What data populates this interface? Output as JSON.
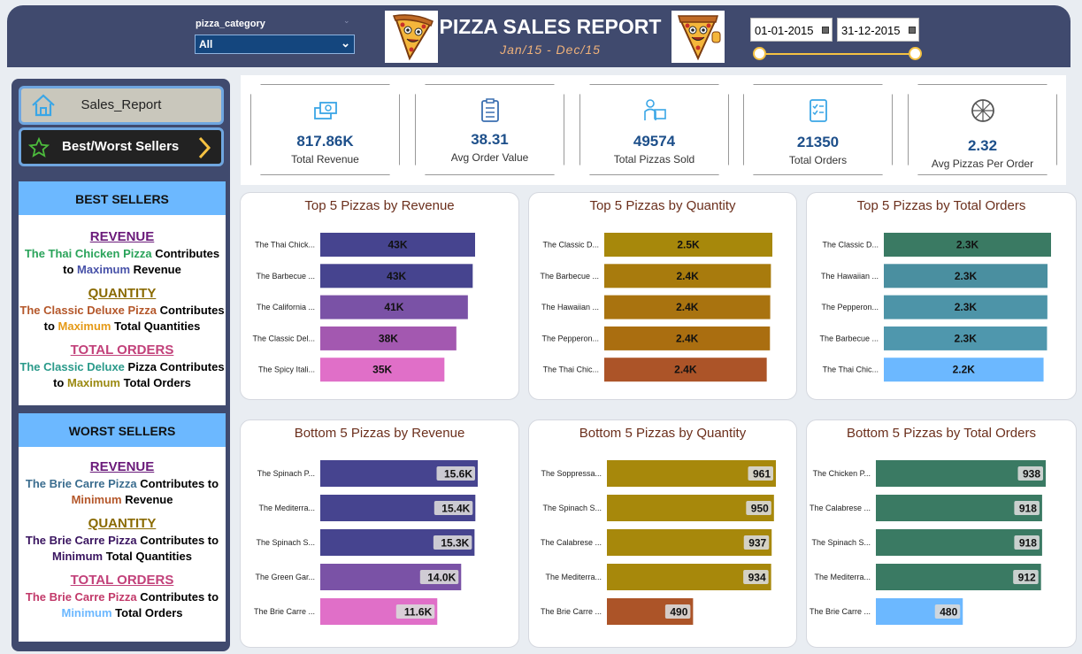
{
  "header": {
    "title": "PIZZA SALES REPORT",
    "subtitle": "Jan/15  -  Dec/15",
    "slicer_label": "pizza_category",
    "slicer_value": "All",
    "date_start": "01-01-2015",
    "date_end": "31-12-2015"
  },
  "nav": {
    "sales_report": "Sales_Report",
    "best_worst": "Best/Worst Sellers"
  },
  "best_sellers": {
    "title": "BEST SELLERS",
    "revenue_heading": "REVENUE",
    "revenue_pizza": "The Thai Chicken Pizza",
    "revenue_mid": " Contributes to ",
    "revenue_key": "Maximum",
    "revenue_tail": " Revenue",
    "quantity_heading": "QUANTITY",
    "quantity_pizza": "The Classic Deluxe Pizza",
    "quantity_mid": " Contributes to ",
    "quantity_key": "Maximum",
    "quantity_tail": " Total Quantities",
    "orders_heading": "TOTAL ORDERS",
    "orders_pizza": "The Classic Deluxe",
    "orders_mid": " Pizza Contributes to ",
    "orders_key": "Maximum",
    "orders_tail": " Total Orders"
  },
  "worst_sellers": {
    "title": "WORST SELLERS",
    "revenue_heading": "REVENUE",
    "revenue_pizza": "The Brie Carre Pizza",
    "revenue_mid": " Contributes to ",
    "revenue_key": "Minimum",
    "revenue_tail": " Revenue",
    "quantity_heading": "QUANTITY",
    "quantity_pizza": "The Brie Carre Pizza",
    "quantity_mid": " Contributes to ",
    "quantity_key": "Minimum",
    "quantity_tail": " Total Quantities",
    "orders_heading": "TOTAL ORDERS",
    "orders_pizza": "The Brie Carre Pizza",
    "orders_mid": " Contributes to ",
    "orders_key": "Minimum",
    "orders_tail": " Total Orders"
  },
  "kpis": [
    {
      "value": "817.86K",
      "label": "Total Revenue",
      "icon": "money-icon"
    },
    {
      "value": "38.31",
      "label": "Avg Order Value",
      "icon": "clipboard-icon"
    },
    {
      "value": "49574",
      "label": "Total Pizzas Sold",
      "icon": "delivery-icon"
    },
    {
      "value": "21350",
      "label": "Total Orders",
      "icon": "checklist-icon"
    },
    {
      "value": "2.32",
      "label": "Avg Pizzas Per Order",
      "icon": "pizza-icon"
    }
  ],
  "colors": {
    "header_bg": "#404a6e",
    "accent_gold": "#f5c242",
    "title_brown": "#6b2f1c",
    "kpi_value": "#1d4f8a",
    "best_head": "#6cb8ff"
  },
  "chart_data": [
    {
      "type": "bar",
      "orientation": "horizontal",
      "title": "Top 5 Pizzas by Revenue",
      "categories": [
        "The Thai Chick...",
        "The Barbecue ...",
        "The California ...",
        "The Classic Del...",
        "The Spicy Itali..."
      ],
      "values": [
        43434,
        42768,
        41410,
        38180,
        34831
      ],
      "labels": [
        "43K",
        "43K",
        "41K",
        "38K",
        "35K"
      ],
      "colors": [
        "#46448f",
        "#46448f",
        "#7a52a6",
        "#a358b0",
        "#e06fc8"
      ],
      "label_style": "center"
    },
    {
      "type": "bar",
      "orientation": "horizontal",
      "title": "Top 5 Pizzas by Quantity",
      "categories": [
        "The Classic D...",
        "The Barbecue ...",
        "The Hawaiian ...",
        "The Pepperon...",
        "The Thai Chic..."
      ],
      "values": [
        2453,
        2432,
        2422,
        2418,
        2371
      ],
      "labels": [
        "2.5K",
        "2.4K",
        "2.4K",
        "2.4K",
        "2.4K"
      ],
      "colors": [
        "#a7880b",
        "#a87b0d",
        "#a9730f",
        "#aa6e10",
        "#ac5428"
      ],
      "label_style": "center"
    },
    {
      "type": "bar",
      "orientation": "horizontal",
      "title": "Top 5 Pizzas by Total Orders",
      "categories": [
        "The Classic D...",
        "The Hawaiian ...",
        "The Pepperon...",
        "The Barbecue ...",
        "The Thai Chic..."
      ],
      "values": [
        2329,
        2280,
        2278,
        2273,
        2225
      ],
      "labels": [
        "2.3K",
        "2.3K",
        "2.3K",
        "2.3K",
        "2.2K"
      ],
      "colors": [
        "#3a7a63",
        "#4a8fa0",
        "#4d94a8",
        "#4f97ad",
        "#6cb8ff"
      ],
      "label_style": "center"
    },
    {
      "type": "bar",
      "orientation": "horizontal",
      "title": "Bottom 5 Pizzas by Revenue",
      "categories": [
        "The Spinach P...",
        "The Mediterra...",
        "The Spinach S...",
        "The Green Gar...",
        "The Brie Carre ..."
      ],
      "values": [
        15596,
        15360,
        15278,
        13956,
        11588
      ],
      "labels": [
        "15.6K",
        "15.4K",
        "15.3K",
        "14.0K",
        "11.6K"
      ],
      "colors": [
        "#46448f",
        "#46448f",
        "#46448f",
        "#7a52a6",
        "#e06fc8"
      ],
      "label_style": "end"
    },
    {
      "type": "bar",
      "orientation": "horizontal",
      "title": "Bottom 5 Pizzas by Quantity",
      "categories": [
        "The Soppressa...",
        "The Spinach S...",
        "The Calabrese ...",
        "The Mediterra...",
        "The Brie Carre ..."
      ],
      "values": [
        961,
        950,
        937,
        934,
        490
      ],
      "labels": [
        "961",
        "950",
        "937",
        "934",
        "490"
      ],
      "colors": [
        "#a7880b",
        "#a7880b",
        "#a7880b",
        "#a7880b",
        "#ac5428"
      ],
      "label_style": "end"
    },
    {
      "type": "bar",
      "orientation": "horizontal",
      "title": "Bottom 5 Pizzas by Total Orders",
      "categories": [
        "The Chicken P...",
        "The Calabrese ...",
        "The Spinach S...",
        "The Mediterra...",
        "The Brie Carre ..."
      ],
      "values": [
        938,
        918,
        918,
        912,
        480
      ],
      "labels": [
        "938",
        "918",
        "918",
        "912",
        "480"
      ],
      "colors": [
        "#3a7a63",
        "#3a7a63",
        "#3a7a63",
        "#3a7a63",
        "#6cb8ff"
      ],
      "label_style": "end"
    }
  ]
}
